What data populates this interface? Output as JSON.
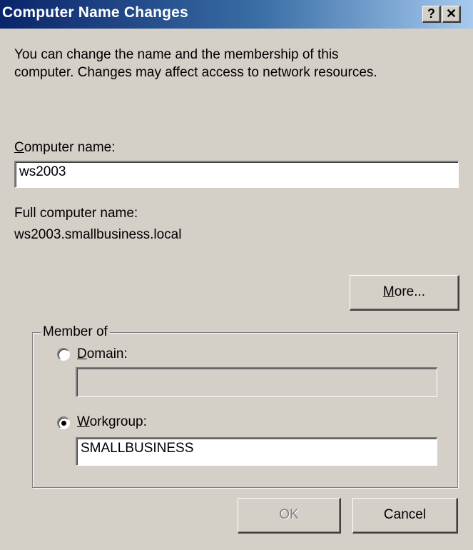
{
  "window": {
    "title": "Computer Name Changes",
    "help_button": "?",
    "close_button": "✕"
  },
  "intro": {
    "line1": "You can change the name and the membership of this",
    "line2": "computer. Changes may affect access to network resources."
  },
  "computer_name": {
    "label_mnemonic": "C",
    "label_rest": "omputer name:",
    "value": "ws2003"
  },
  "full_name": {
    "label": "Full computer name:",
    "value": "ws2003.smallbusiness.local"
  },
  "more_button": {
    "mnemonic": "M",
    "rest": "ore..."
  },
  "member_of": {
    "label": "Member of",
    "domain": {
      "label_mnemonic": "D",
      "label_rest": "omain:",
      "value": "",
      "selected": false
    },
    "workgroup": {
      "label_mnemonic": "W",
      "label_rest": "orkgroup:",
      "value": "SMALLBUSINESS",
      "selected": true
    }
  },
  "buttons": {
    "ok": "OK",
    "cancel": "Cancel"
  }
}
